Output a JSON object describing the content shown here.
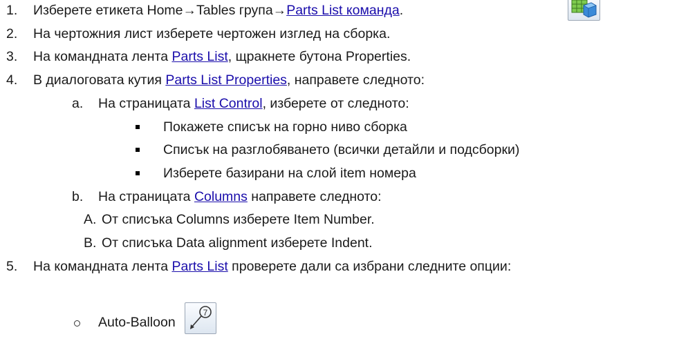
{
  "steps": [
    {
      "num": "1.",
      "pre": "Изберете етикета Home→Tables група→",
      "link": "Parts List команда",
      "post": "."
    },
    {
      "num": "2.",
      "pre": "На чертожния лист изберете чертожен изглед на сборка.",
      "link": "",
      "post": ""
    },
    {
      "num": "3.",
      "pre": "На командната лента ",
      "link": "Parts List",
      "post": ", щракнете бутона Properties."
    },
    {
      "num": "4.",
      "pre": "В диалоговата кутия ",
      "link": "Parts List Properties",
      "post": ", направете следното:"
    },
    {
      "num": "5.",
      "pre": "На командната лента ",
      "link": "Parts List",
      "post": " проверете дали са избрани следните опции:"
    }
  ],
  "sub_a": {
    "num": "a.",
    "pre": "На страницата ",
    "link": "List Control",
    "post": ", изберете от следното:"
  },
  "bullets": [
    "Покажете списък на горно ниво сборка",
    "Списък на разглобяването (всички детайли и подсборки)",
    "Изберете базирани на слой item номера"
  ],
  "sub_b": {
    "num": "b.",
    "pre": "На страницата ",
    "link": "Columns",
    "post": " направете следното:"
  },
  "sub_items": [
    {
      "num": "A.",
      "text": "От списъка Columns изберете Item Number."
    },
    {
      "num": "B.",
      "text": "От списъка Data alignment изберете Indent."
    }
  ],
  "option": {
    "label": "Auto-Balloon",
    "balloon_number": "7"
  },
  "icons": {
    "parts_list": "parts-list-icon",
    "auto_balloon": "auto-balloon-icon"
  },
  "colors": {
    "link": "#1a0dab",
    "text": "#1a1a1a"
  }
}
